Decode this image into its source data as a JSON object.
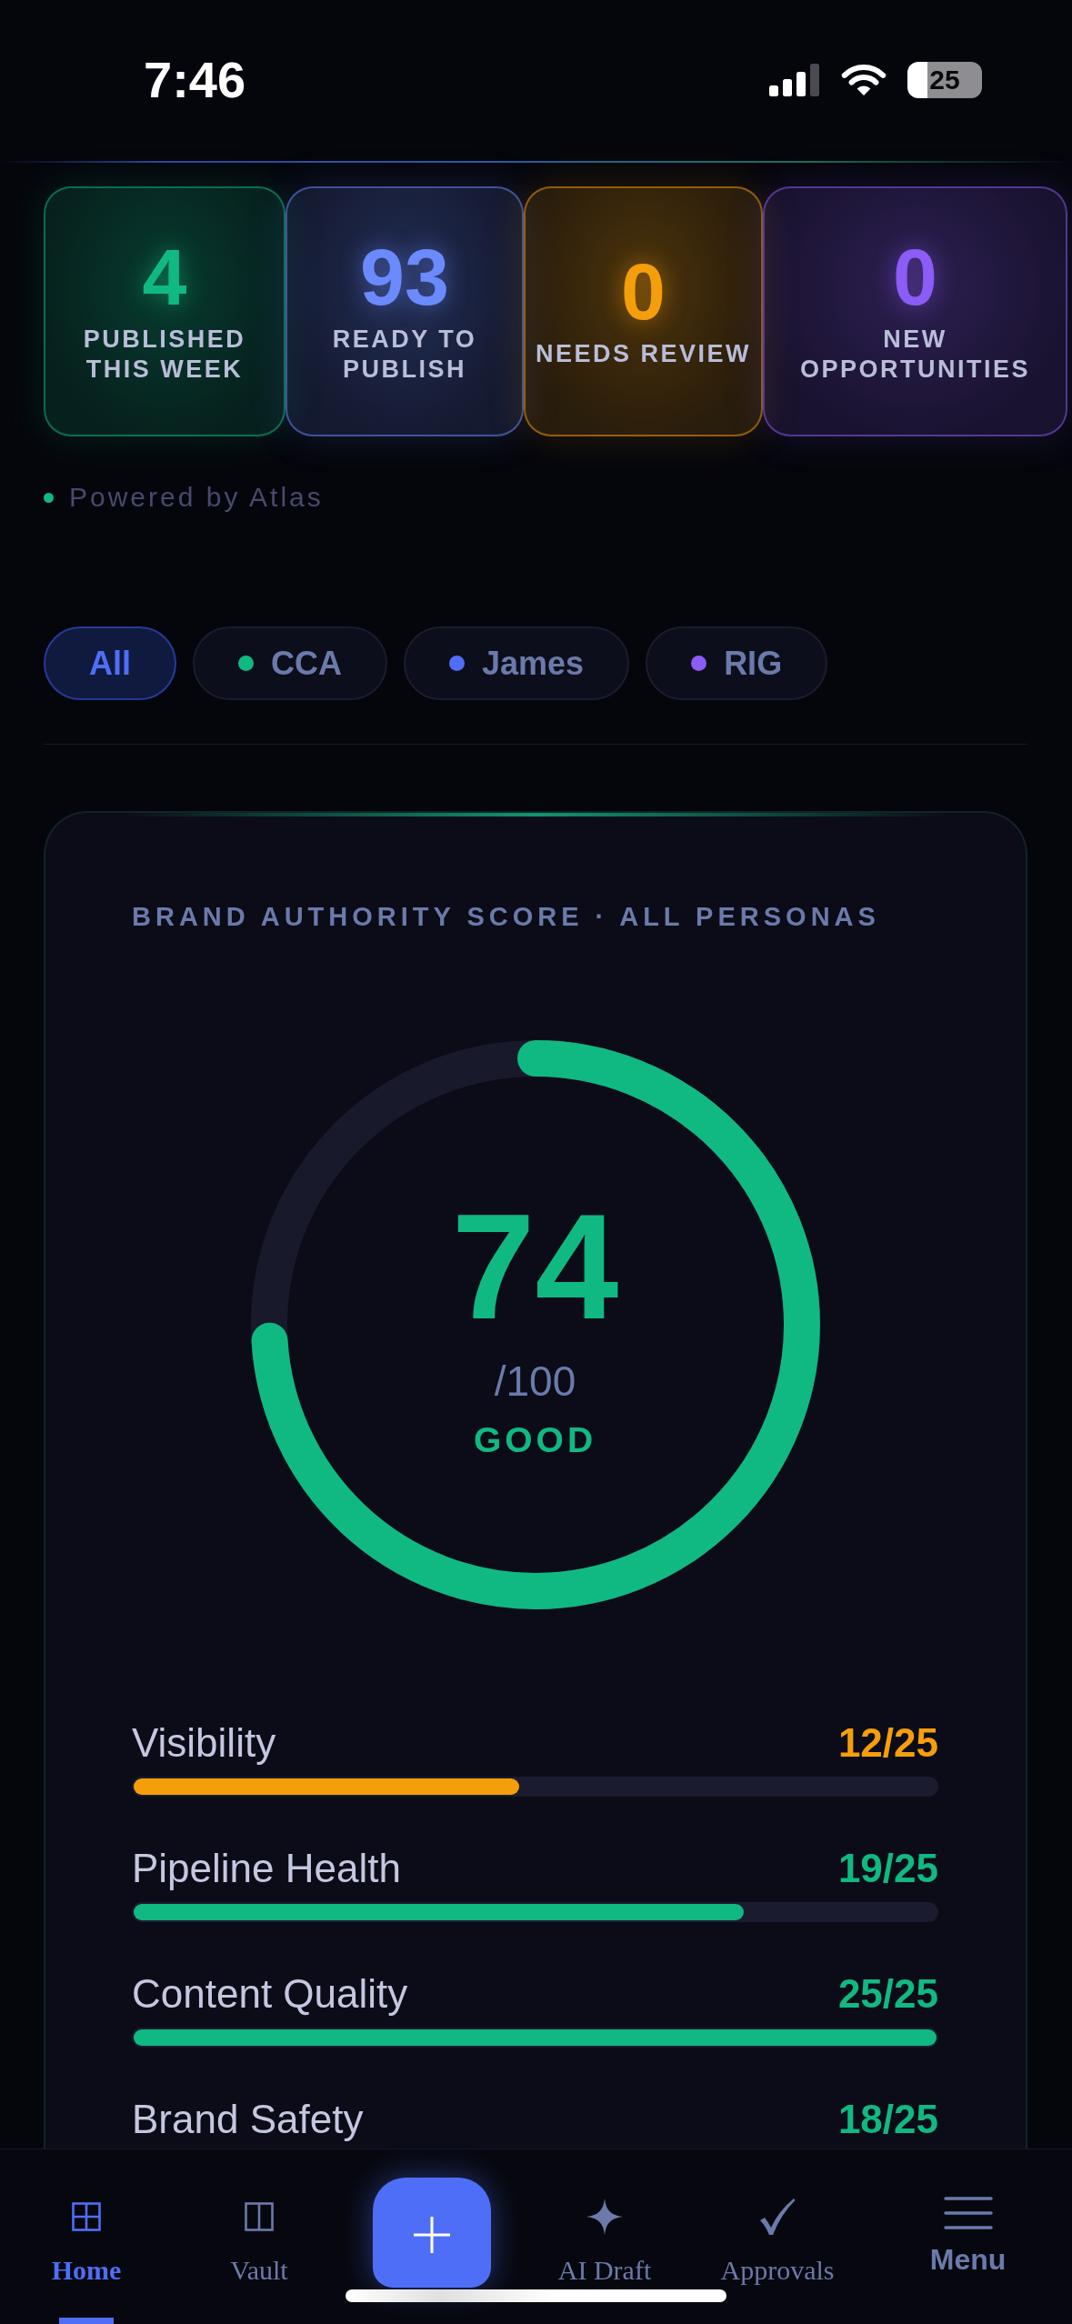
{
  "status_bar": {
    "time": "7:46",
    "battery": "25"
  },
  "stats": [
    {
      "value": "4",
      "label": "PUBLISHED THIS WEEK",
      "color": "#10b981"
    },
    {
      "value": "93",
      "label": "READY TO PUBLISH",
      "color": "#6b8afd"
    },
    {
      "value": "0",
      "label": "NEEDS REVIEW",
      "color": "#f59e0b"
    },
    {
      "value": "0",
      "label": "NEW OPPORTUNITIES",
      "color": "#8b5cf6"
    }
  ],
  "powered_by": "Powered by Atlas",
  "filters": [
    {
      "label": "All",
      "selected": true
    },
    {
      "label": "CCA",
      "selected": false,
      "color": "#10b981"
    },
    {
      "label": "James",
      "selected": false,
      "color": "#4f6ef7"
    },
    {
      "label": "RIG",
      "selected": false,
      "color": "#8b5cf6"
    }
  ],
  "score_card": {
    "title": "BRAND AUTHORITY SCORE · ALL PERSONAS",
    "score": "74",
    "max": "/100",
    "rating": "GOOD",
    "level": 0.74,
    "metrics": [
      {
        "label": "Visibility",
        "value": "12/25",
        "level": 0.48,
        "color": "#f59e0b"
      },
      {
        "label": "Pipeline Health",
        "value": "19/25",
        "level": 0.76,
        "color": "#10b981"
      },
      {
        "label": "Content Quality",
        "value": "25/25",
        "level": 1,
        "color": "#10b981"
      },
      {
        "label": "Brand Safety",
        "value": "18/25",
        "color": "#10b981"
      }
    ]
  },
  "bottom_nav": [
    {
      "kind": "tab",
      "label": "Home",
      "selected": true
    },
    {
      "kind": "tab",
      "label": "Vault",
      "selected": false
    },
    {
      "kind": "action"
    },
    {
      "kind": "tab",
      "label": "AI Draft",
      "selected": false
    },
    {
      "kind": "tab",
      "label": "Approvals",
      "selected": false
    },
    {
      "kind": "menu",
      "label": "Menu",
      "selected": false
    }
  ]
}
